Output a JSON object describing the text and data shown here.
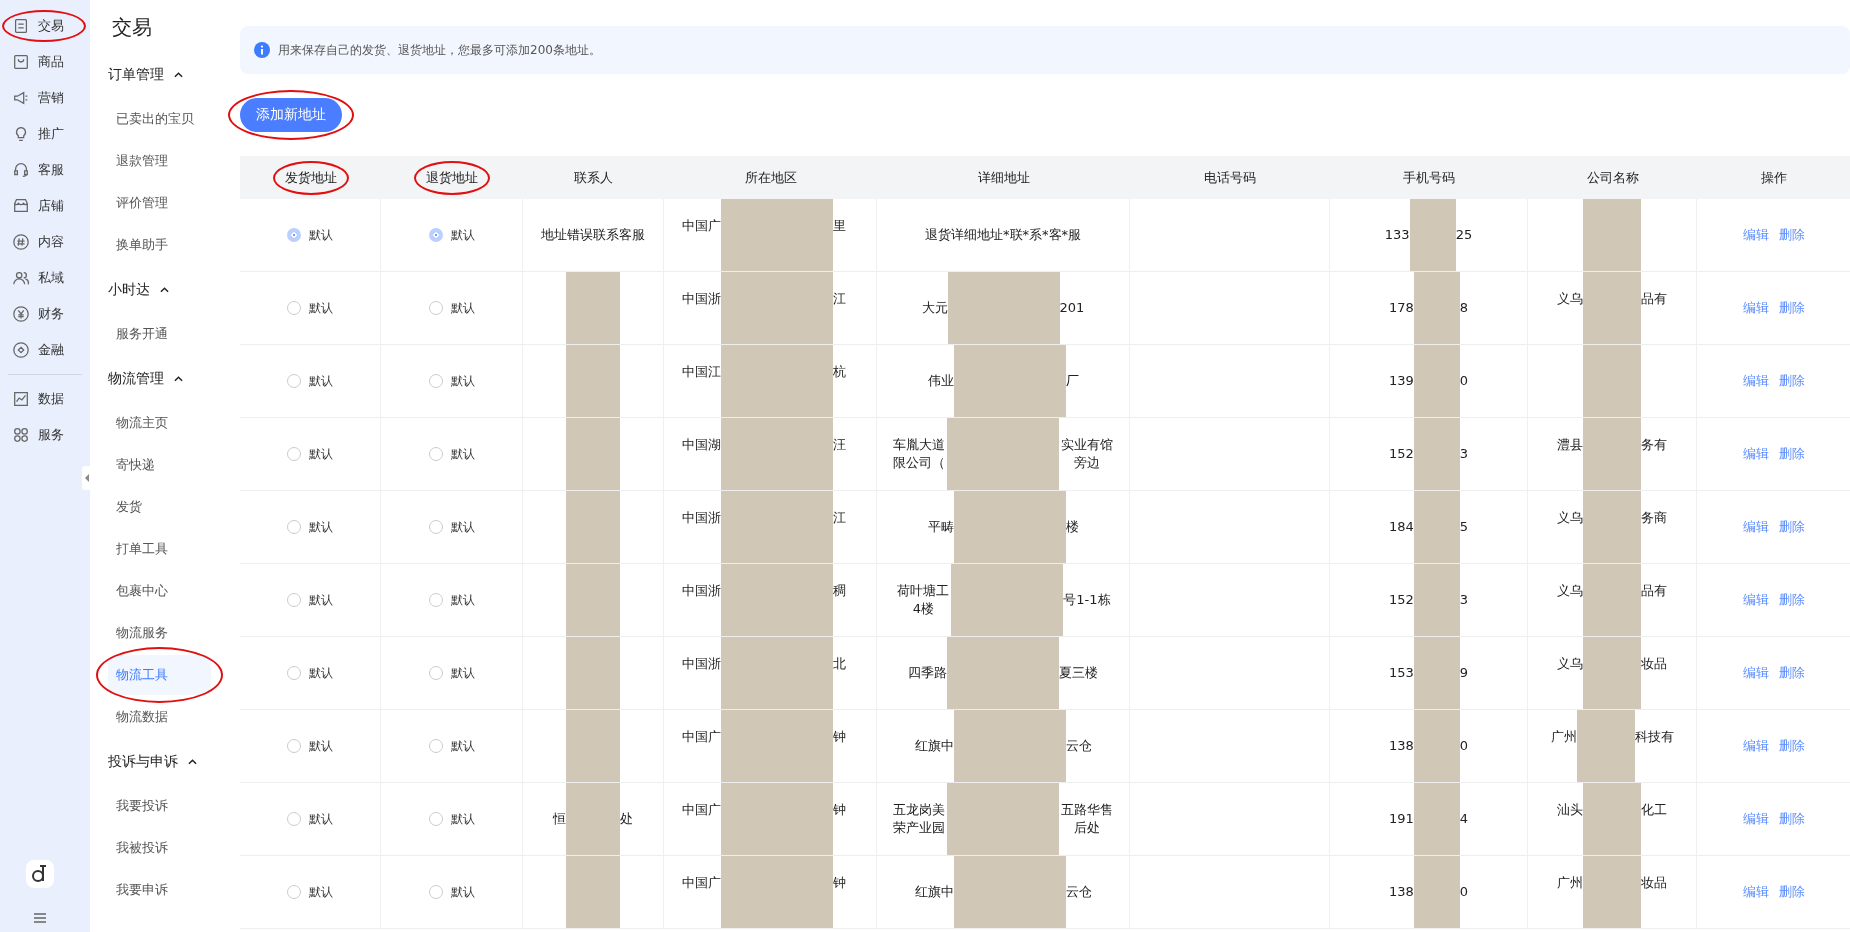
{
  "rail": {
    "sections": [
      {
        "items": [
          {
            "label": "交易",
            "circled": true
          },
          {
            "label": "商品",
            "circled": false
          },
          {
            "label": "营销",
            "circled": false
          },
          {
            "label": "推广",
            "circled": false
          },
          {
            "label": "客服",
            "circled": false
          },
          {
            "label": "店铺",
            "circled": false
          },
          {
            "label": "内容",
            "circled": false
          },
          {
            "label": "私域",
            "circled": false
          },
          {
            "label": "财务",
            "circled": false
          },
          {
            "label": "金融",
            "circled": false
          }
        ]
      },
      {
        "items": [
          {
            "label": "数据",
            "circled": false
          },
          {
            "label": "服务",
            "circled": false
          }
        ]
      }
    ]
  },
  "nav": {
    "title": "交易",
    "groups": [
      {
        "label": "订单管理",
        "expanded": true,
        "items": [
          {
            "label": "已卖出的宝贝",
            "selected": false,
            "circled": false
          },
          {
            "label": "退款管理",
            "selected": false,
            "circled": false
          },
          {
            "label": "评价管理",
            "selected": false,
            "circled": false
          },
          {
            "label": "换单助手",
            "selected": false,
            "circled": false
          }
        ]
      },
      {
        "label": "小时达",
        "expanded": true,
        "items": [
          {
            "label": "服务开通",
            "selected": false,
            "circled": false
          }
        ]
      },
      {
        "label": "物流管理",
        "expanded": true,
        "items": [
          {
            "label": "物流主页",
            "selected": false,
            "circled": false
          },
          {
            "label": "寄快递",
            "selected": false,
            "circled": false
          },
          {
            "label": "发货",
            "selected": false,
            "circled": false
          },
          {
            "label": "打单工具",
            "selected": false,
            "circled": false
          },
          {
            "label": "包裹中心",
            "selected": false,
            "circled": false
          },
          {
            "label": "物流服务",
            "selected": false,
            "circled": false
          },
          {
            "label": "物流工具",
            "selected": true,
            "circled": true
          },
          {
            "label": "物流数据",
            "selected": false,
            "circled": false
          }
        ]
      },
      {
        "label": "投诉与申诉",
        "expanded": true,
        "items": [
          {
            "label": "我要投诉",
            "selected": false,
            "circled": false
          },
          {
            "label": "我被投诉",
            "selected": false,
            "circled": false
          },
          {
            "label": "我要申诉",
            "selected": false,
            "circled": false
          }
        ]
      }
    ]
  },
  "notice": "用来保存自己的发货、退货地址，您最多可添加200条地址。",
  "add_button": {
    "label": "添加新地址",
    "circled": true
  },
  "table": {
    "columns": [
      {
        "label": "发货地址",
        "circled": true
      },
      {
        "label": "退货地址",
        "circled": true
      },
      {
        "label": "联系人",
        "circled": false
      },
      {
        "label": "所在地区",
        "circled": false
      },
      {
        "label": "详细地址",
        "circled": false
      },
      {
        "label": "电话号码",
        "circled": false
      },
      {
        "label": "手机号码",
        "circled": false
      },
      {
        "label": "公司名称",
        "circled": false
      },
      {
        "label": "操作",
        "circled": false
      }
    ],
    "rows": [
      {
        "ship_default": {
          "label": "默认",
          "selected": true
        },
        "return_default": {
          "label": "默认",
          "selected": true
        },
        "contact": {
          "before": "地址错误联系客服",
          "redacted": false
        },
        "region": {
          "before": "中国广",
          "after": "里",
          "redacted": true
        },
        "detail": {
          "before": "退货详细地址*联*系*客*服",
          "redacted": false
        },
        "mobile": {
          "before": "133",
          "after": "25",
          "redacted": true
        },
        "company": {
          "redacted": true
        },
        "actions": [
          "编辑",
          "删除"
        ]
      },
      {
        "ship_default": {
          "label": "默认",
          "selected": false
        },
        "return_default": {
          "label": "默认",
          "selected": false
        },
        "contact": {
          "redacted": true
        },
        "region": {
          "before": "中国浙",
          "after": "江",
          "redacted": true
        },
        "detail": {
          "before": "大元",
          "after": "201",
          "redacted": true
        },
        "mobile": {
          "before": "178",
          "after": "8",
          "redacted": true
        },
        "company": {
          "before": "义乌",
          "after": "品有",
          "redacted": true
        },
        "actions": [
          "编辑",
          "删除"
        ]
      },
      {
        "ship_default": {
          "label": "默认",
          "selected": false
        },
        "return_default": {
          "label": "默认",
          "selected": false
        },
        "contact": {
          "redacted": true
        },
        "region": {
          "before": "中国江",
          "after": "杭",
          "redacted": true
        },
        "detail": {
          "before": "伟业",
          "after": "厂",
          "redacted": true
        },
        "mobile": {
          "before": "139",
          "after": "0",
          "redacted": true
        },
        "company": {
          "redacted": true
        },
        "actions": [
          "编辑",
          "删除"
        ]
      },
      {
        "ship_default": {
          "label": "默认",
          "selected": false
        },
        "return_default": {
          "label": "默认",
          "selected": false
        },
        "contact": {
          "redacted": true
        },
        "region": {
          "before": "中国湖",
          "after": "汪",
          "redacted": true
        },
        "detail": {
          "before": "车胤大道限公司（",
          "after": "实业有馆旁边",
          "redacted": true
        },
        "mobile": {
          "before": "152",
          "after": "3",
          "redacted": true
        },
        "company": {
          "before": "澧县",
          "after": "务有",
          "redacted": true
        },
        "actions": [
          "编辑",
          "删除"
        ]
      },
      {
        "ship_default": {
          "label": "默认",
          "selected": false
        },
        "return_default": {
          "label": "默认",
          "selected": false
        },
        "contact": {
          "redacted": true
        },
        "region": {
          "before": "中国浙",
          "after": "江",
          "redacted": true
        },
        "detail": {
          "before": "平畴",
          "after": "楼",
          "redacted": true
        },
        "mobile": {
          "before": "184",
          "after": "5",
          "redacted": true
        },
        "company": {
          "before": "义乌",
          "after": "务商",
          "redacted": true
        },
        "actions": [
          "编辑",
          "删除"
        ]
      },
      {
        "ship_default": {
          "label": "默认",
          "selected": false
        },
        "return_default": {
          "label": "默认",
          "selected": false
        },
        "contact": {
          "redacted": true
        },
        "region": {
          "before": "中国浙",
          "after": "稠",
          "redacted": true
        },
        "detail": {
          "before": "荷叶塘工4楼",
          "after": "号1-1栋",
          "redacted": true
        },
        "mobile": {
          "before": "152",
          "after": "3",
          "redacted": true
        },
        "company": {
          "before": "义乌",
          "after": "品有",
          "redacted": true
        },
        "actions": [
          "编辑",
          "删除"
        ]
      },
      {
        "ship_default": {
          "label": "默认",
          "selected": false
        },
        "return_default": {
          "label": "默认",
          "selected": false
        },
        "contact": {
          "redacted": true
        },
        "region": {
          "before": "中国浙",
          "after": "北",
          "redacted": true
        },
        "detail": {
          "before": "四季路",
          "after": "夏三楼",
          "redacted": true
        },
        "mobile": {
          "before": "153",
          "after": "9",
          "redacted": true
        },
        "company": {
          "before": "义乌",
          "after": "妆品",
          "redacted": true
        },
        "actions": [
          "编辑",
          "删除"
        ]
      },
      {
        "ship_default": {
          "label": "默认",
          "selected": false
        },
        "return_default": {
          "label": "默认",
          "selected": false
        },
        "contact": {
          "redacted": true
        },
        "region": {
          "before": "中国广",
          "after": "钟",
          "redacted": true
        },
        "detail": {
          "before": "红旗中",
          "after": "云仓",
          "redacted": true
        },
        "mobile": {
          "before": "138",
          "after": "0",
          "redacted": true
        },
        "company": {
          "before": "广州",
          "after": "科技有",
          "redacted": true
        },
        "actions": [
          "编辑",
          "删除"
        ]
      },
      {
        "ship_default": {
          "label": "默认",
          "selected": false
        },
        "return_default": {
          "label": "默认",
          "selected": false
        },
        "contact": {
          "before": "恒",
          "after": "处",
          "redacted": true
        },
        "region": {
          "before": "中国广",
          "after": "钟",
          "redacted": true
        },
        "detail": {
          "before": "五龙岗美荣产业园",
          "after": "五路华售后处",
          "redacted": true
        },
        "mobile": {
          "before": "191",
          "after": "4",
          "redacted": true
        },
        "company": {
          "before": "汕头",
          "after": "化工",
          "redacted": true
        },
        "actions": [
          "编辑",
          "删除"
        ]
      },
      {
        "ship_default": {
          "label": "默认",
          "selected": false
        },
        "return_default": {
          "label": "默认",
          "selected": false
        },
        "contact": {
          "redacted": true
        },
        "region": {
          "before": "中国广",
          "after": "钟",
          "redacted": true
        },
        "detail": {
          "before": "红旗中",
          "after": "云仓",
          "redacted": true
        },
        "mobile": {
          "before": "138",
          "after": "0",
          "redacted": true
        },
        "company": {
          "before": "广州",
          "after": "妆品",
          "redacted": true
        },
        "actions": [
          "编辑",
          "删除"
        ]
      }
    ]
  }
}
